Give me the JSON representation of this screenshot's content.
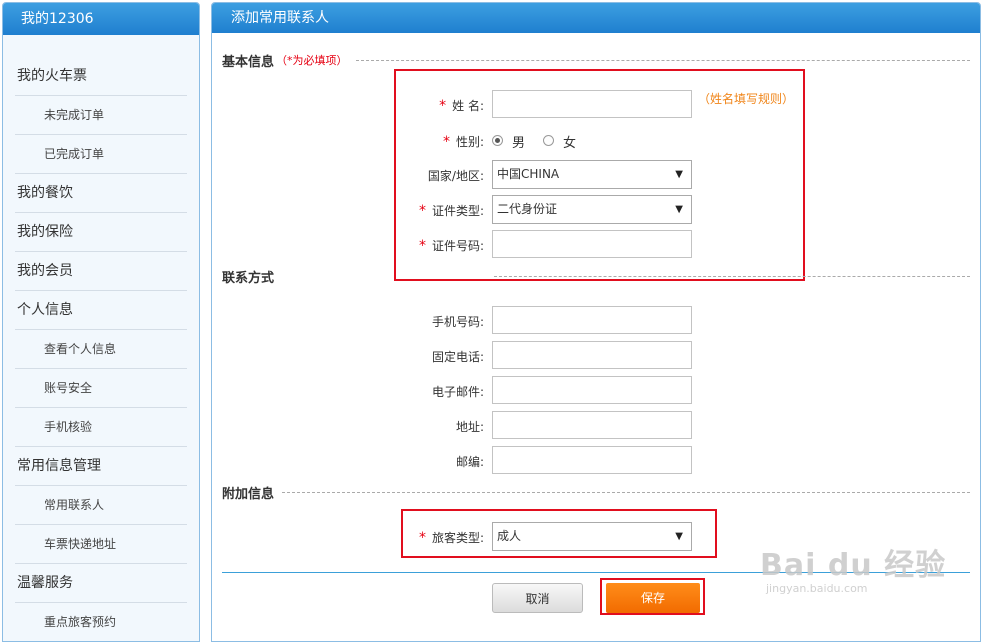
{
  "sidebar": {
    "title": "我的12306",
    "items": [
      {
        "label": "我的火车票",
        "sub": false
      },
      {
        "label": "未完成订单",
        "sub": true
      },
      {
        "label": "已完成订单",
        "sub": true
      },
      {
        "label": "我的餐饮",
        "sub": false
      },
      {
        "label": "我的保险",
        "sub": false
      },
      {
        "label": "我的会员",
        "sub": false
      },
      {
        "label": "个人信息",
        "sub": false
      },
      {
        "label": "查看个人信息",
        "sub": true
      },
      {
        "label": "账号安全",
        "sub": true
      },
      {
        "label": "手机核验",
        "sub": true
      },
      {
        "label": "常用信息管理",
        "sub": false
      },
      {
        "label": "常用联系人",
        "sub": true
      },
      {
        "label": "车票快递地址",
        "sub": true
      },
      {
        "label": "温馨服务",
        "sub": false
      },
      {
        "label": "重点旅客预约",
        "sub": true
      }
    ]
  },
  "main": {
    "title": "添加常用联系人",
    "basic": {
      "title": "基本信息",
      "required_note": "（*为必填项）",
      "required_mark": "*",
      "name_label": "姓 名:",
      "name_value": "",
      "name_hint": "（姓名填写规则）",
      "gender_label": "性别:",
      "gender_options": [
        "男",
        "女"
      ],
      "gender_selected": "男",
      "country_label": "国家/地区:",
      "country_value": "中国CHINA",
      "idtype_label": "证件类型:",
      "idtype_value": "二代身份证",
      "idnum_label": "证件号码:",
      "idnum_value": ""
    },
    "contact": {
      "title": "联系方式",
      "fields": [
        {
          "label": "手机号码:",
          "value": ""
        },
        {
          "label": "固定电话:",
          "value": ""
        },
        {
          "label": "电子邮件:",
          "value": ""
        },
        {
          "label": "地址:",
          "value": ""
        },
        {
          "label": "邮编:",
          "value": ""
        }
      ]
    },
    "extra": {
      "title": "附加信息",
      "passenger_type_label": "旅客类型:",
      "passenger_type_value": "成人"
    },
    "buttons": {
      "cancel": "取消",
      "save": "保存"
    }
  },
  "watermark": {
    "main": "Bai du 经验",
    "sub": "jingyan.baidu.com"
  },
  "colors": {
    "header_blue": "#1f7fcf",
    "required_red": "#e60012",
    "highlight_red": "#e10e1e",
    "hint_orange": "#f08519",
    "save_orange": "#f26b00"
  }
}
